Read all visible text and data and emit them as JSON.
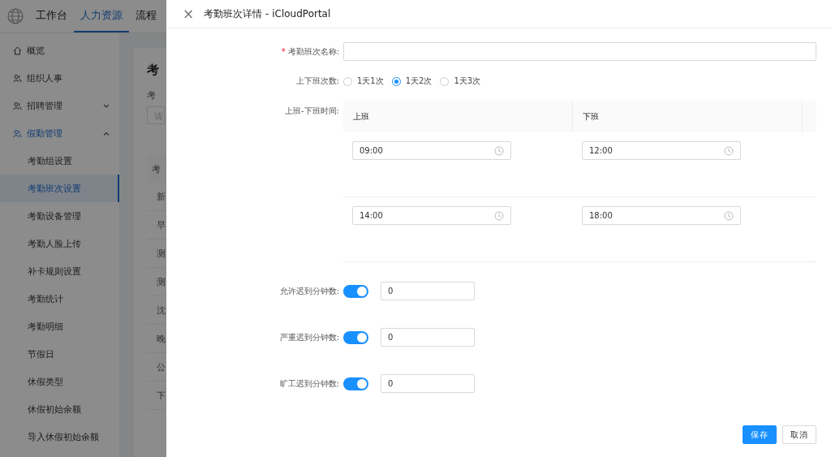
{
  "header": {
    "nav": [
      {
        "label": "工作台",
        "selected": false
      },
      {
        "label": "人力资源",
        "selected": true
      },
      {
        "label": "流程",
        "selected": false
      }
    ]
  },
  "sidebar": {
    "items": [
      {
        "label": "概览",
        "selected": false
      },
      {
        "label": "组织人事",
        "selected": false
      },
      {
        "label": "招聘管理",
        "selected": false,
        "expanded": false
      },
      {
        "label": "假勤管理",
        "selected": true,
        "expanded": true,
        "children": [
          {
            "label": "考勤组设置",
            "selected": false
          },
          {
            "label": "考勤班次设置",
            "selected": true
          },
          {
            "label": "考勤设备管理",
            "selected": false
          },
          {
            "label": "考勤人脸上传",
            "selected": false
          },
          {
            "label": "补卡规则设置",
            "selected": false
          },
          {
            "label": "考勤统计",
            "selected": false
          },
          {
            "label": "考勤明细",
            "selected": false
          },
          {
            "label": "节假日",
            "selected": false
          },
          {
            "label": "休假类型",
            "selected": false
          },
          {
            "label": "休假初始余额",
            "selected": false
          },
          {
            "label": "导入休假初始余额",
            "selected": false
          }
        ]
      }
    ]
  },
  "background_page": {
    "title": "考",
    "filter_label": "考",
    "filter_placeholder": "请",
    "table_header": "考",
    "rows": [
      "新",
      "早",
      "测",
      "测",
      "沈",
      "晚",
      "公",
      "下"
    ]
  },
  "drawer": {
    "close": "×",
    "title": "考勤班次详情 - iCloudPortal",
    "name_field": {
      "label": "考勤班次名称:",
      "required_mark": "*"
    },
    "count_field": {
      "label": "上下班次数:",
      "options": [
        {
          "label": "1天1次",
          "selected": false
        },
        {
          "label": "1天2次",
          "selected": true
        },
        {
          "label": "1天3次",
          "selected": false
        }
      ]
    },
    "time_field": {
      "label": "上班-下班时间:",
      "columns": [
        "上班",
        "下班"
      ],
      "rows": [
        {
          "start": "09:00",
          "end": "12:00"
        },
        {
          "start": "14:00",
          "end": "18:00"
        }
      ]
    },
    "late_fields": [
      {
        "label": "允许迟到分钟数:",
        "on": true,
        "value": "0"
      },
      {
        "label": "严重迟到分钟数:",
        "on": true,
        "value": "0"
      },
      {
        "label": "旷工迟到分钟数:",
        "on": true,
        "value": "0"
      }
    ],
    "buttons": [
      {
        "label": "保存",
        "kind": "primary"
      },
      {
        "label": "取消",
        "kind": "default"
      }
    ]
  }
}
